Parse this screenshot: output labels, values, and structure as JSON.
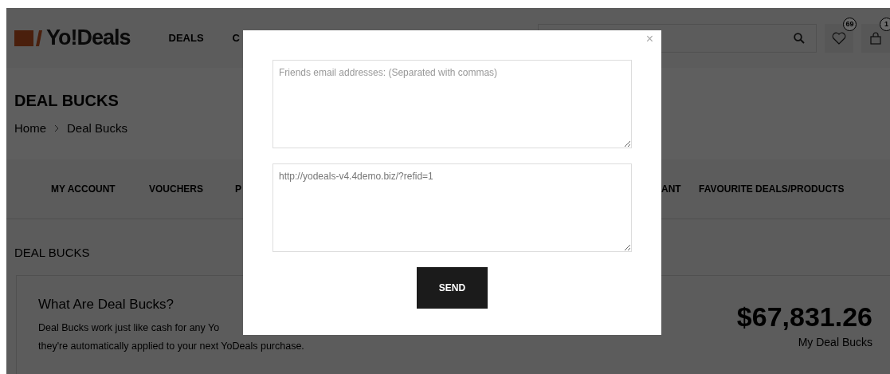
{
  "header": {
    "logo": "Yo!Deals",
    "nav": [
      "DEALS",
      "C"
    ],
    "wishlist_badge": "69",
    "cart_badge": "1"
  },
  "page_title": "DEAL BUCKS",
  "breadcrumb": [
    "Home",
    "Deal Bucks"
  ],
  "tabs": [
    "MY ACCOUNT",
    "VOUCHERS",
    "P",
    "ANT",
    "FAVOURITE DEALS/PRODUCTS"
  ],
  "section_title": "DEAL BUCKS",
  "info": {
    "heading": "What Are Deal Bucks?",
    "lines": [
      "Deal Bucks work just like cash for any Yo",
      "they're automatically applied to your next YoDeals purchase."
    ],
    "amount": "$67,831.26",
    "amount_label": "My Deal Bucks"
  },
  "modal": {
    "close": "×",
    "emails": {
      "placeholder": "Friends email addresses: (Separated with commas)"
    },
    "link": {
      "value": "http://yodeals-v4.4demo.biz/?refid=1"
    },
    "send": "SEND"
  }
}
